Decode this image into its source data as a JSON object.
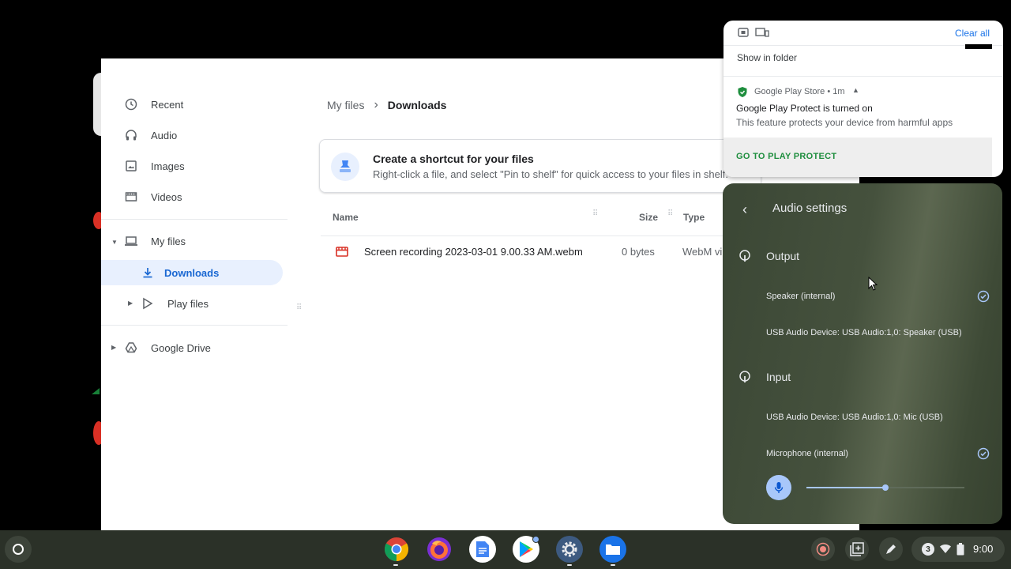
{
  "files": {
    "nav": {
      "recent": "Recent",
      "audio": "Audio",
      "images": "Images",
      "videos": "Videos",
      "my_files": "My files",
      "downloads": "Downloads",
      "play_files": "Play files",
      "google_drive": "Google Drive"
    },
    "breadcrumb": [
      "My files",
      "Downloads"
    ],
    "banner": {
      "title": "Create a shortcut for your files",
      "text": "Right-click a file, and select \"Pin to shelf\" for quick access to your files in shelf."
    },
    "columns": [
      "Name",
      "Size",
      "Type"
    ],
    "rows": [
      {
        "name": "Screen recording 2023-03-01 9.00.33 AM.webm",
        "size": "0 bytes",
        "type": "WebM vi"
      }
    ]
  },
  "notifications": {
    "clear_all": "Clear all",
    "first": {
      "action": "Show in folder"
    },
    "second": {
      "source": "Google Play Store • 1m",
      "title": "Google Play Protect is turned on",
      "body": "This feature protects your device from harmful apps",
      "action": "GO TO PLAY PROTECT"
    }
  },
  "audio_settings": {
    "title": "Audio settings",
    "output": {
      "label": "Output",
      "devices": [
        {
          "name": "Speaker (internal)",
          "selected": true
        },
        {
          "name": "USB Audio Device: USB Audio:1,0: Speaker (USB)",
          "selected": false
        }
      ]
    },
    "input": {
      "label": "Input",
      "devices": [
        {
          "name": "USB Audio Device: USB Audio:1,0: Mic (USB)",
          "selected": false
        },
        {
          "name": "Microphone (internal)",
          "selected": true
        }
      ],
      "gain_percent": 50
    }
  },
  "shelf": {
    "apps": [
      "chrome-icon",
      "firefox-icon",
      "docs-icon",
      "play-store-icon",
      "settings-icon",
      "files-icon"
    ],
    "notification_count": "3",
    "time": "9:00"
  },
  "colors": {
    "accent": "#1a73e8",
    "audio_panel": "#45513d",
    "play_green": "#1e8e3e"
  }
}
